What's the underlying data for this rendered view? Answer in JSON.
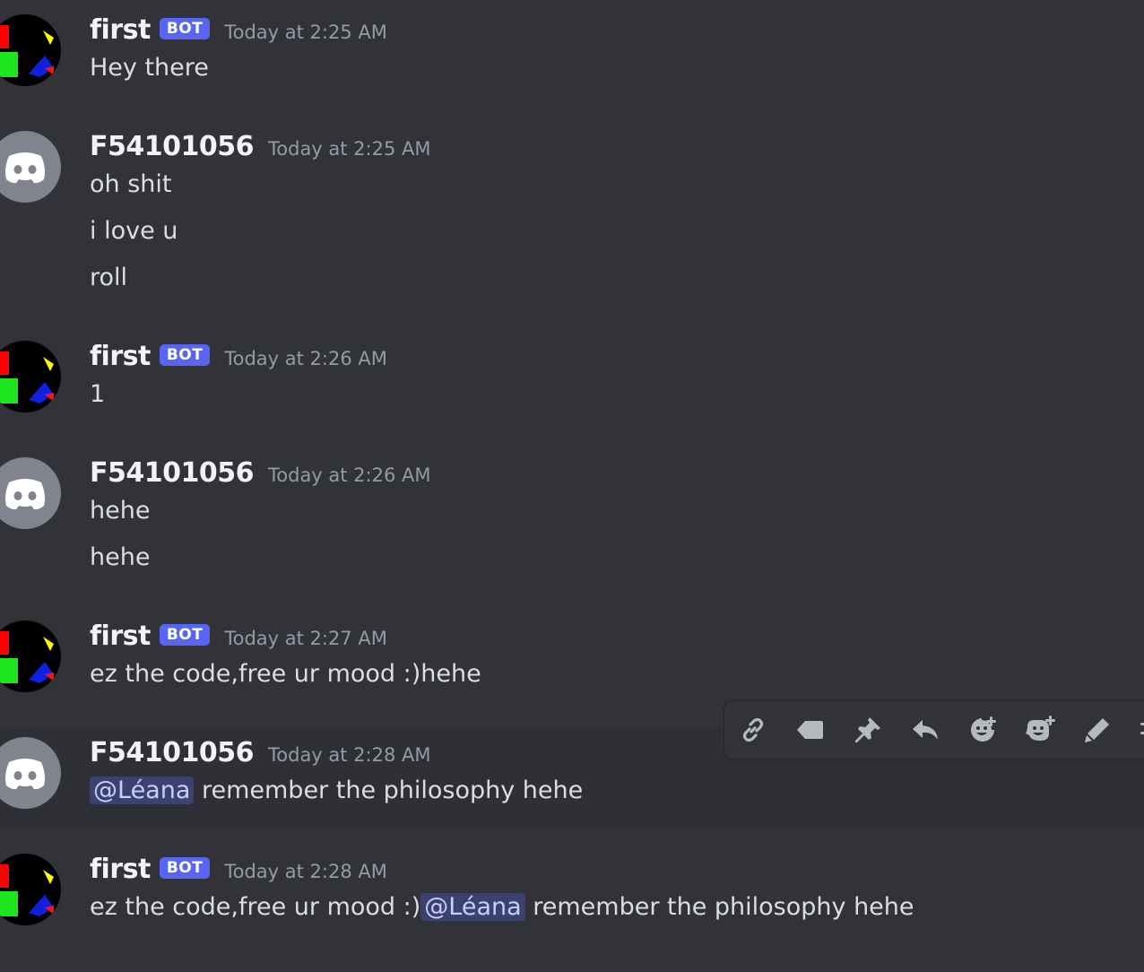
{
  "messages": [
    {
      "author": "first",
      "bot": true,
      "badge": "BOT",
      "time": "Today at 2:25 AM",
      "lines": [
        "Hey there"
      ]
    },
    {
      "author": "F54101056",
      "bot": false,
      "time": "Today at 2:25 AM",
      "lines": [
        "oh shit",
        "i love u",
        "roll"
      ]
    },
    {
      "author": "first",
      "bot": true,
      "badge": "BOT",
      "time": "Today at 2:26 AM",
      "lines": [
        "1"
      ]
    },
    {
      "author": "F54101056",
      "bot": false,
      "time": "Today at 2:26 AM",
      "lines": [
        "hehe",
        "hehe"
      ]
    },
    {
      "author": "first",
      "bot": true,
      "badge": "BOT",
      "time": "Today at 2:27 AM",
      "lines": [
        "ez the code,free ur mood :)hehe"
      ]
    },
    {
      "author": "F54101056",
      "bot": false,
      "time": "Today at 2:28 AM",
      "mention": "@Léana",
      "after_mention": " remember the philosophy hehe"
    },
    {
      "author": "first",
      "bot": true,
      "badge": "BOT",
      "time": "Today at 2:28 AM",
      "before_mention": "ez the code,free ur mood :)",
      "mention": "@Léana",
      "after_mention": " remember the philosophy hehe"
    }
  ],
  "toolbar": {
    "icons": [
      "link-icon",
      "tag-icon",
      "pin-icon",
      "reply-icon",
      "add-reaction-icon",
      "super-reaction-icon",
      "edit-icon",
      "more-icon"
    ]
  },
  "colors": {
    "background": "#313338",
    "bot_badge": "#5865f2",
    "mention_bg": "#3c4270",
    "mention_text": "#c9cdfb",
    "timestamp": "#949ba4"
  }
}
